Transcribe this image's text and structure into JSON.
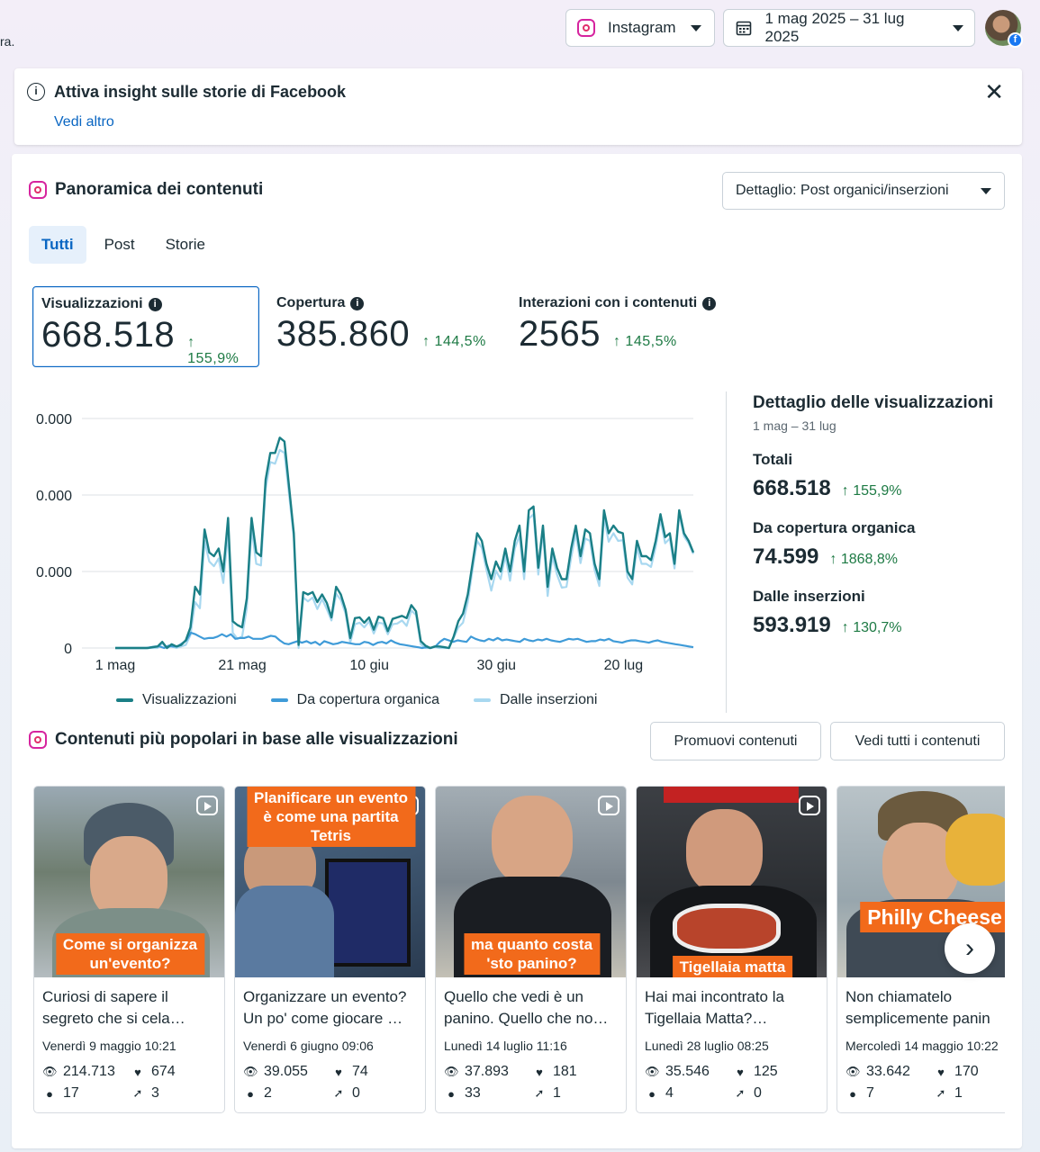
{
  "topbar": {
    "cut_text": "ra.",
    "platform": "Instagram",
    "date_range": "1 mag 2025 – 31 lug 2025"
  },
  "banner": {
    "title": "Attiva insight sulle storie di Facebook",
    "link": "Vedi altro"
  },
  "overview": {
    "title": "Panoramica dei contenuti",
    "dropdown": "Dettaglio: Post organici/inserzioni",
    "tabs": [
      "Tutti",
      "Post",
      "Storie"
    ],
    "metrics": [
      {
        "label": "Visualizzazioni",
        "value": "668.518",
        "change": "↑ 155,9%"
      },
      {
        "label": "Copertura",
        "value": "385.860",
        "change": "↑ 144,5%"
      },
      {
        "label": "Interazioni con i contenuti",
        "value": "2565",
        "change": "↑ 145,5%"
      }
    ]
  },
  "chart_data": {
    "type": "line",
    "y_tick_labels": [
      "0.000",
      "0.000",
      "0.000",
      "0"
    ],
    "ylim": [
      0,
      30000
    ],
    "x_tick_labels": [
      "1 mag",
      "21 mag",
      "10 giu",
      "30 giu",
      "20 lug"
    ],
    "x_range": [
      "2025-05-01",
      "2025-07-31"
    ],
    "grid": true,
    "legend_position": "bottom",
    "series": [
      {
        "name": "Visualizzazioni",
        "color": "#1a7f86",
        "values": [
          0,
          0,
          0,
          0,
          0,
          0,
          0,
          0,
          100,
          200,
          800,
          0,
          500,
          200,
          400,
          1000,
          2700,
          8000,
          7000,
          15500,
          12500,
          12000,
          13000,
          10000,
          17000,
          3500,
          3000,
          2700,
          6500,
          17000,
          12500,
          12000,
          22000,
          25500,
          25500,
          27500,
          27000,
          21000,
          15000,
          400,
          7300,
          7000,
          7300,
          6000,
          7000,
          5900,
          4000,
          8000,
          7000,
          5000,
          1300,
          3900,
          4000,
          3300,
          4000,
          2400,
          4100,
          3900,
          2200,
          3800,
          4000,
          4200,
          3900,
          5600,
          4800,
          900,
          300,
          0,
          200,
          200,
          100,
          0,
          1500,
          3500,
          4500,
          7000,
          11000,
          15000,
          14000,
          11000,
          9000,
          11300,
          10000,
          13000,
          10000,
          14000,
          16000,
          10000,
          18000,
          18500,
          10500,
          16000,
          8000,
          13000,
          10500,
          9000,
          9000,
          13000,
          16000,
          12000,
          15500,
          15000,
          11000,
          9000,
          18000,
          15000,
          16000,
          15200,
          15000,
          10000,
          9000,
          14000,
          12000,
          12000,
          11500,
          14000,
          17500,
          14500,
          15000,
          11000,
          18000,
          15000,
          14000,
          12500
        ]
      },
      {
        "name": "Da copertura organica",
        "color": "#3f9bd8",
        "values": [
          0,
          0,
          0,
          0,
          0,
          0,
          0,
          0,
          100,
          200,
          200,
          0,
          300,
          200,
          200,
          600,
          1000,
          2000,
          1800,
          1500,
          1200,
          1300,
          1300,
          1500,
          1800,
          1500,
          1800,
          1200,
          1300,
          1300,
          1500,
          1200,
          1200,
          1200,
          1400,
          1600,
          1500,
          1000,
          600,
          500,
          700,
          900,
          700,
          900,
          600,
          800,
          400,
          900,
          700,
          500,
          600,
          800,
          700,
          600,
          500,
          500,
          800,
          700,
          400,
          700,
          800,
          600,
          1000,
          700,
          500,
          400,
          300,
          200,
          100,
          0,
          100,
          0,
          200,
          800,
          1200,
          1000,
          800,
          1000,
          900,
          800,
          1500,
          1200,
          1000,
          900,
          1200,
          1000,
          1300,
          1000,
          1100,
          1000,
          900,
          800,
          1200,
          1000,
          900,
          1100,
          1000,
          1200,
          1000,
          900,
          800,
          1000,
          1200,
          1100,
          1200,
          1000,
          800,
          900,
          900,
          1100,
          1000,
          1200,
          900,
          800,
          700,
          900,
          1000,
          1000,
          900,
          800,
          700,
          900,
          1000,
          800,
          700,
          600,
          500,
          400,
          300,
          200,
          100
        ]
      },
      {
        "name": "Dalle inserzioni",
        "color": "#a8d8f0",
        "values": [
          0,
          0,
          0,
          0,
          0,
          0,
          0,
          0,
          0,
          0,
          600,
          0,
          200,
          0,
          200,
          400,
          1700,
          6000,
          5200,
          14000,
          11300,
          10700,
          11700,
          8500,
          15200,
          2000,
          1200,
          1500,
          5200,
          15700,
          11000,
          10800,
          20800,
          24300,
          24100,
          25900,
          25500,
          20000,
          14400,
          0,
          6600,
          6100,
          6600,
          5100,
          6400,
          5100,
          3600,
          7100,
          6300,
          4500,
          700,
          3100,
          3300,
          2700,
          3500,
          1900,
          3300,
          3200,
          1800,
          3100,
          3200,
          3600,
          2900,
          4900,
          4300,
          500,
          0,
          0,
          100,
          0,
          0,
          0,
          1300,
          2700,
          3300,
          6000,
          10200,
          14000,
          13100,
          10200,
          7500,
          10100,
          9000,
          12100,
          8800,
          13000,
          14700,
          9000,
          16900,
          17500,
          9600,
          15200,
          6800,
          12000,
          9600,
          7900,
          8000,
          11800,
          15000,
          11100,
          14300,
          14000,
          10200,
          8100,
          17100,
          13900,
          15000,
          14000,
          14100,
          9200,
          8300,
          13100,
          11000,
          11000,
          10600,
          13200,
          16800,
          13700,
          14300,
          10400,
          17500,
          14600,
          13700,
          12300
        ]
      }
    ]
  },
  "detail": {
    "title": "Dettaglio delle visualizzazioni",
    "range": "1 mag – 31 lug",
    "blocks": [
      {
        "label": "Totali",
        "value": "668.518",
        "change": "↑ 155,9%"
      },
      {
        "label": "Da copertura organica",
        "value": "74.599",
        "change": "↑ 1868,8%"
      },
      {
        "label": "Dalle inserzioni",
        "value": "593.919",
        "change": "↑ 130,7%"
      }
    ]
  },
  "popular": {
    "title": "Contenuti più popolari in base alle visualizzazioni",
    "promote_btn": "Promuovi contenuti",
    "see_all_btn": "Vedi tutti i contenuti",
    "posts": [
      {
        "overlay": "Come si organizza\nun'evento?",
        "title": "Curiosi di sapere il segreto che si cela…",
        "date": "Venerdì 9 maggio 10:21",
        "views": "214.713",
        "likes": "674",
        "comments": "17",
        "shares": "3"
      },
      {
        "overlay": "Planificare un evento\nè come una partita\nTetris",
        "title": "Organizzare un evento? Un po' come giocare …",
        "date": "Venerdì 6 giugno 09:06",
        "views": "39.055",
        "likes": "74",
        "comments": "2",
        "shares": "0"
      },
      {
        "overlay": "ma quanto costa\n'sto panino?",
        "title": "Quello che vedi è un panino. Quello che no…",
        "date": "Lunedì 14 luglio 11:16",
        "views": "37.893",
        "likes": "181",
        "comments": "33",
        "shares": "1"
      },
      {
        "overlay": "Tigellaia matta",
        "title": "Hai mai incontrato la Tigellaia Matta?…",
        "date": "Lunedì 28 luglio 08:25",
        "views": "35.546",
        "likes": "125",
        "comments": "4",
        "shares": "0"
      },
      {
        "overlay": "Philly Cheese",
        "title": "Non chiamatelo semplicemente panin",
        "date": "Mercoledì 14 maggio 10:22",
        "views": "33.642",
        "likes": "170",
        "comments": "7",
        "shares": "1"
      }
    ]
  },
  "icons": {
    "views": "eye-icon",
    "likes": "heart-icon",
    "comments": "comment-icon",
    "shares": "share-icon",
    "next": "chevron-right-icon"
  }
}
